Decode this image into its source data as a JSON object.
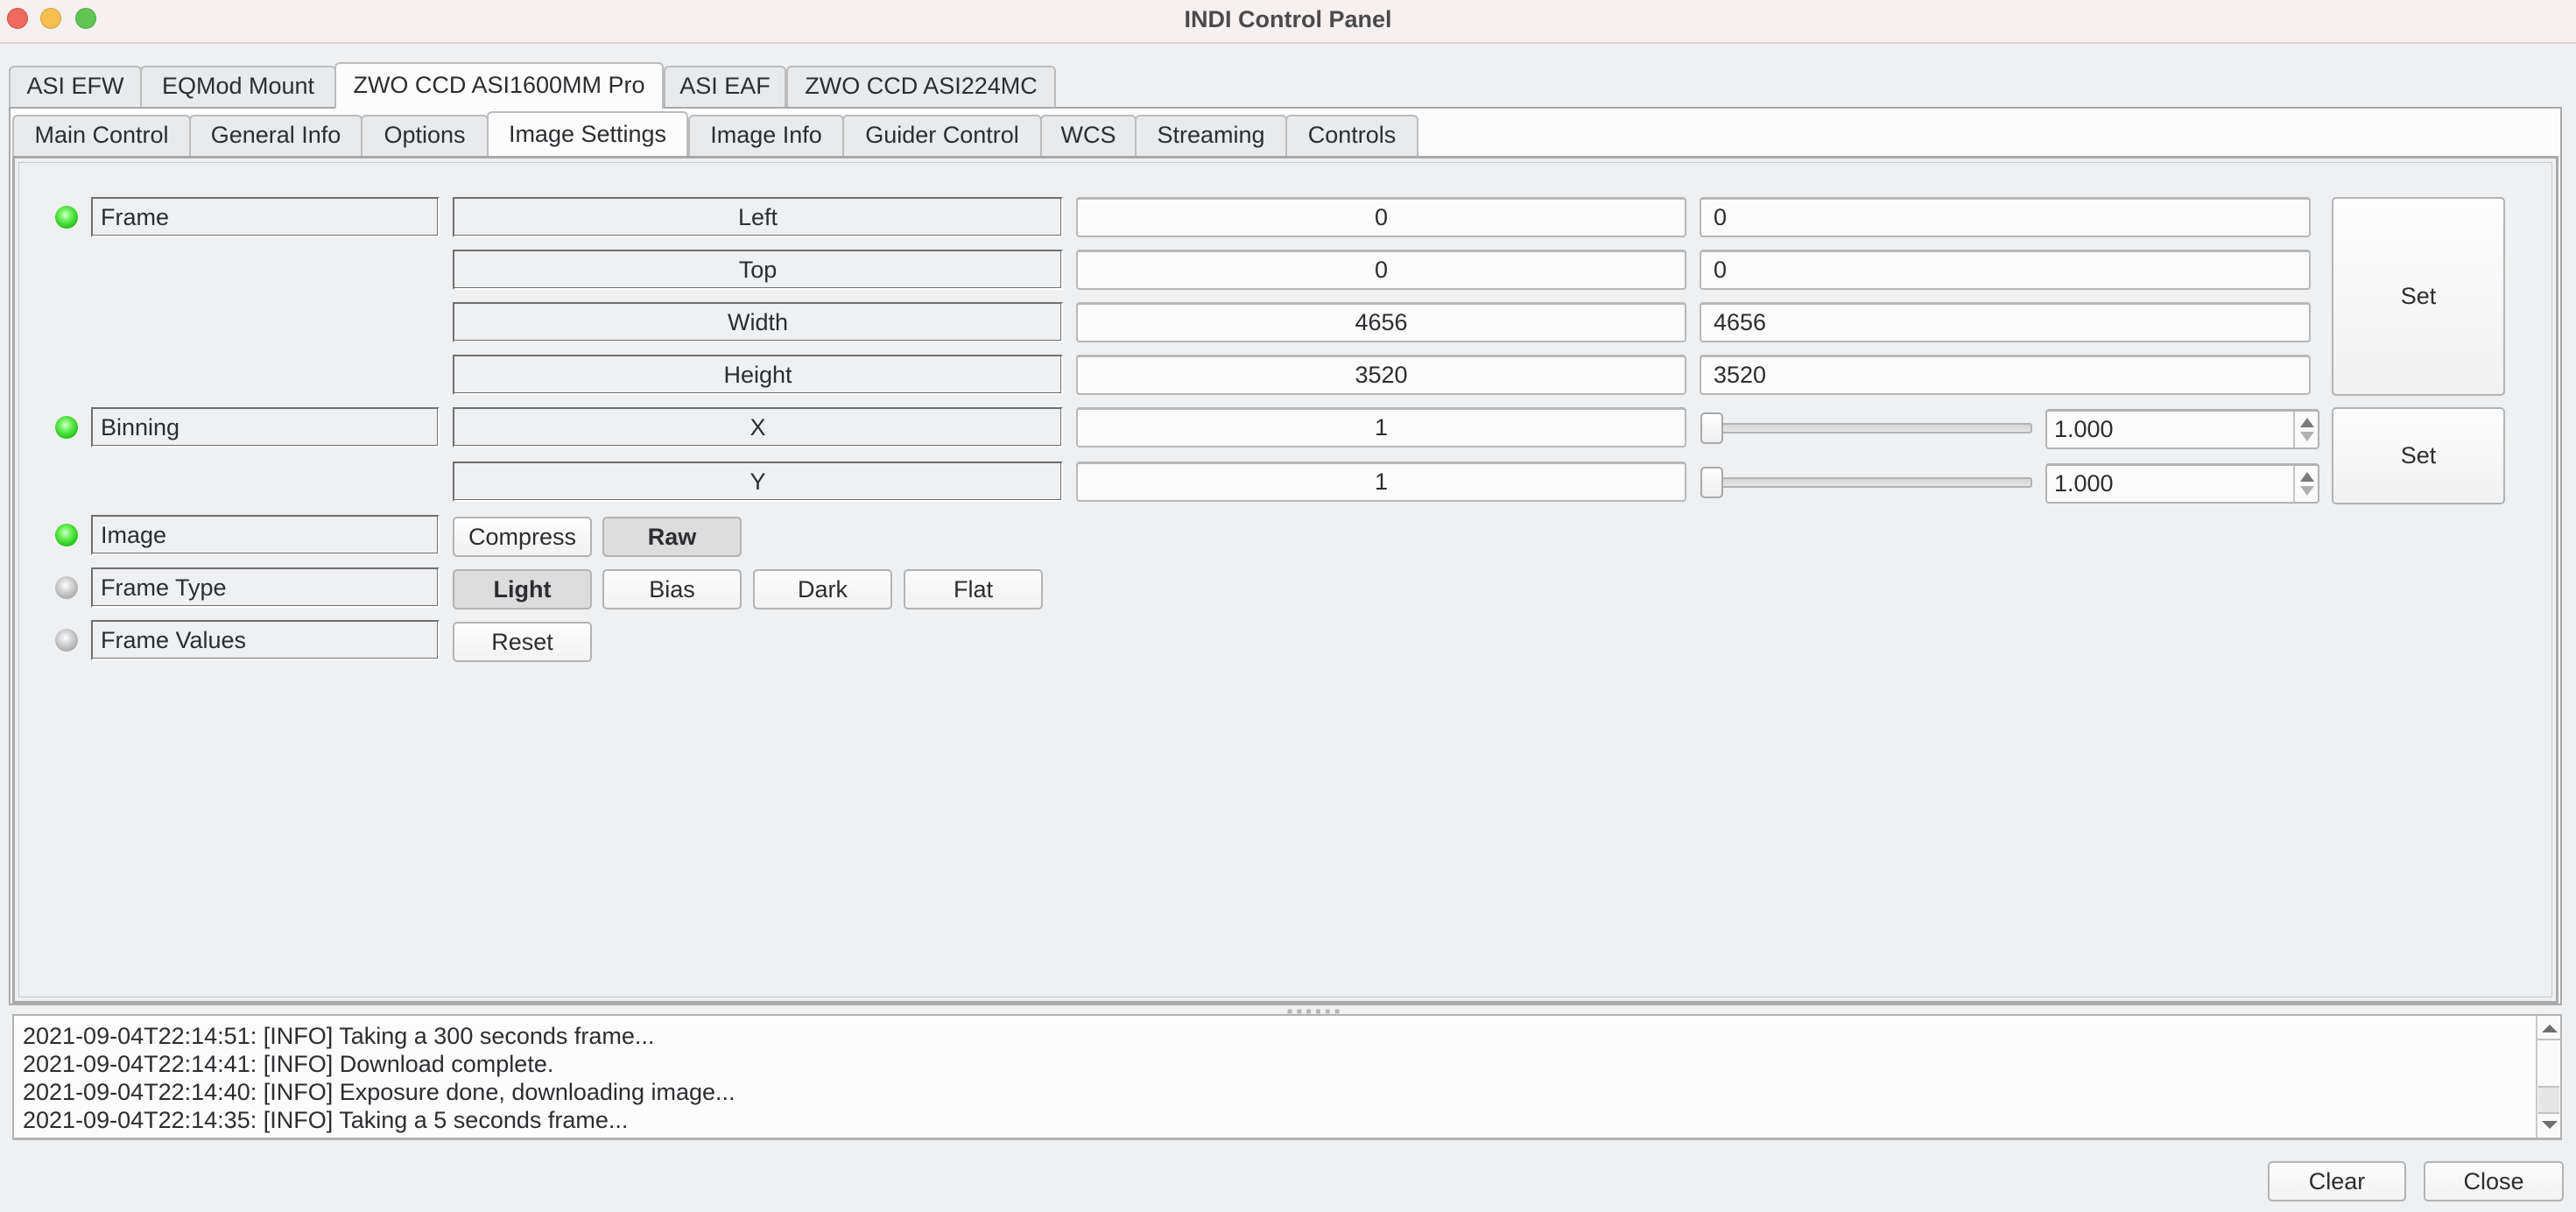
{
  "window": {
    "title": "INDI Control Panel"
  },
  "device_tabs": [
    {
      "label": "ASI EFW",
      "active": false
    },
    {
      "label": "EQMod Mount",
      "active": false
    },
    {
      "label": "ZWO CCD ASI1600MM Pro",
      "active": true
    },
    {
      "label": "ASI EAF",
      "active": false
    },
    {
      "label": "ZWO CCD ASI224MC",
      "active": false
    }
  ],
  "group_tabs": [
    {
      "label": "Main Control",
      "active": false
    },
    {
      "label": "General Info",
      "active": false
    },
    {
      "label": "Options",
      "active": false
    },
    {
      "label": "Image Settings",
      "active": true
    },
    {
      "label": "Image Info",
      "active": false
    },
    {
      "label": "Guider Control",
      "active": false
    },
    {
      "label": "WCS",
      "active": false
    },
    {
      "label": "Streaming",
      "active": false
    },
    {
      "label": "Controls",
      "active": false
    }
  ],
  "properties": {
    "frame": {
      "label": "Frame",
      "state": "ok",
      "set_label": "Set",
      "elements": [
        {
          "name": "Left",
          "value": "0",
          "input": "0"
        },
        {
          "name": "Top",
          "value": "0",
          "input": "0"
        },
        {
          "name": "Width",
          "value": "4656",
          "input": "4656"
        },
        {
          "name": "Height",
          "value": "3520",
          "input": "3520"
        }
      ]
    },
    "binning": {
      "label": "Binning",
      "state": "ok",
      "set_label": "Set",
      "elements": [
        {
          "name": "X",
          "value": "1",
          "spinner": "1.000",
          "slider_fraction": 0.0
        },
        {
          "name": "Y",
          "value": "1",
          "spinner": "1.000",
          "slider_fraction": 0.0
        }
      ]
    },
    "image": {
      "label": "Image",
      "state": "ok",
      "options": [
        {
          "label": "Compress",
          "selected": false
        },
        {
          "label": "Raw",
          "selected": true
        }
      ]
    },
    "frame_type": {
      "label": "Frame Type",
      "state": "idle",
      "options": [
        {
          "label": "Light",
          "selected": true
        },
        {
          "label": "Bias",
          "selected": false
        },
        {
          "label": "Dark",
          "selected": false
        },
        {
          "label": "Flat",
          "selected": false
        }
      ]
    },
    "frame_values": {
      "label": "Frame Values",
      "state": "idle",
      "reset_label": "Reset"
    }
  },
  "log": {
    "lines": [
      "2021-09-04T22:14:51: [INFO] Taking a 300 seconds frame...",
      "2021-09-04T22:14:41: [INFO] Download complete.",
      "2021-09-04T22:14:40: [INFO] Exposure done, downloading image...",
      "2021-09-04T22:14:35: [INFO] Taking a 5 seconds frame..."
    ]
  },
  "footer": {
    "clear_label": "Clear",
    "close_label": "Close"
  },
  "colors": {
    "led_ok": "#3fe030",
    "led_idle": "#b8b8b8",
    "title_bar": "#f6f0f0",
    "window_bg": "#eff0f2"
  }
}
